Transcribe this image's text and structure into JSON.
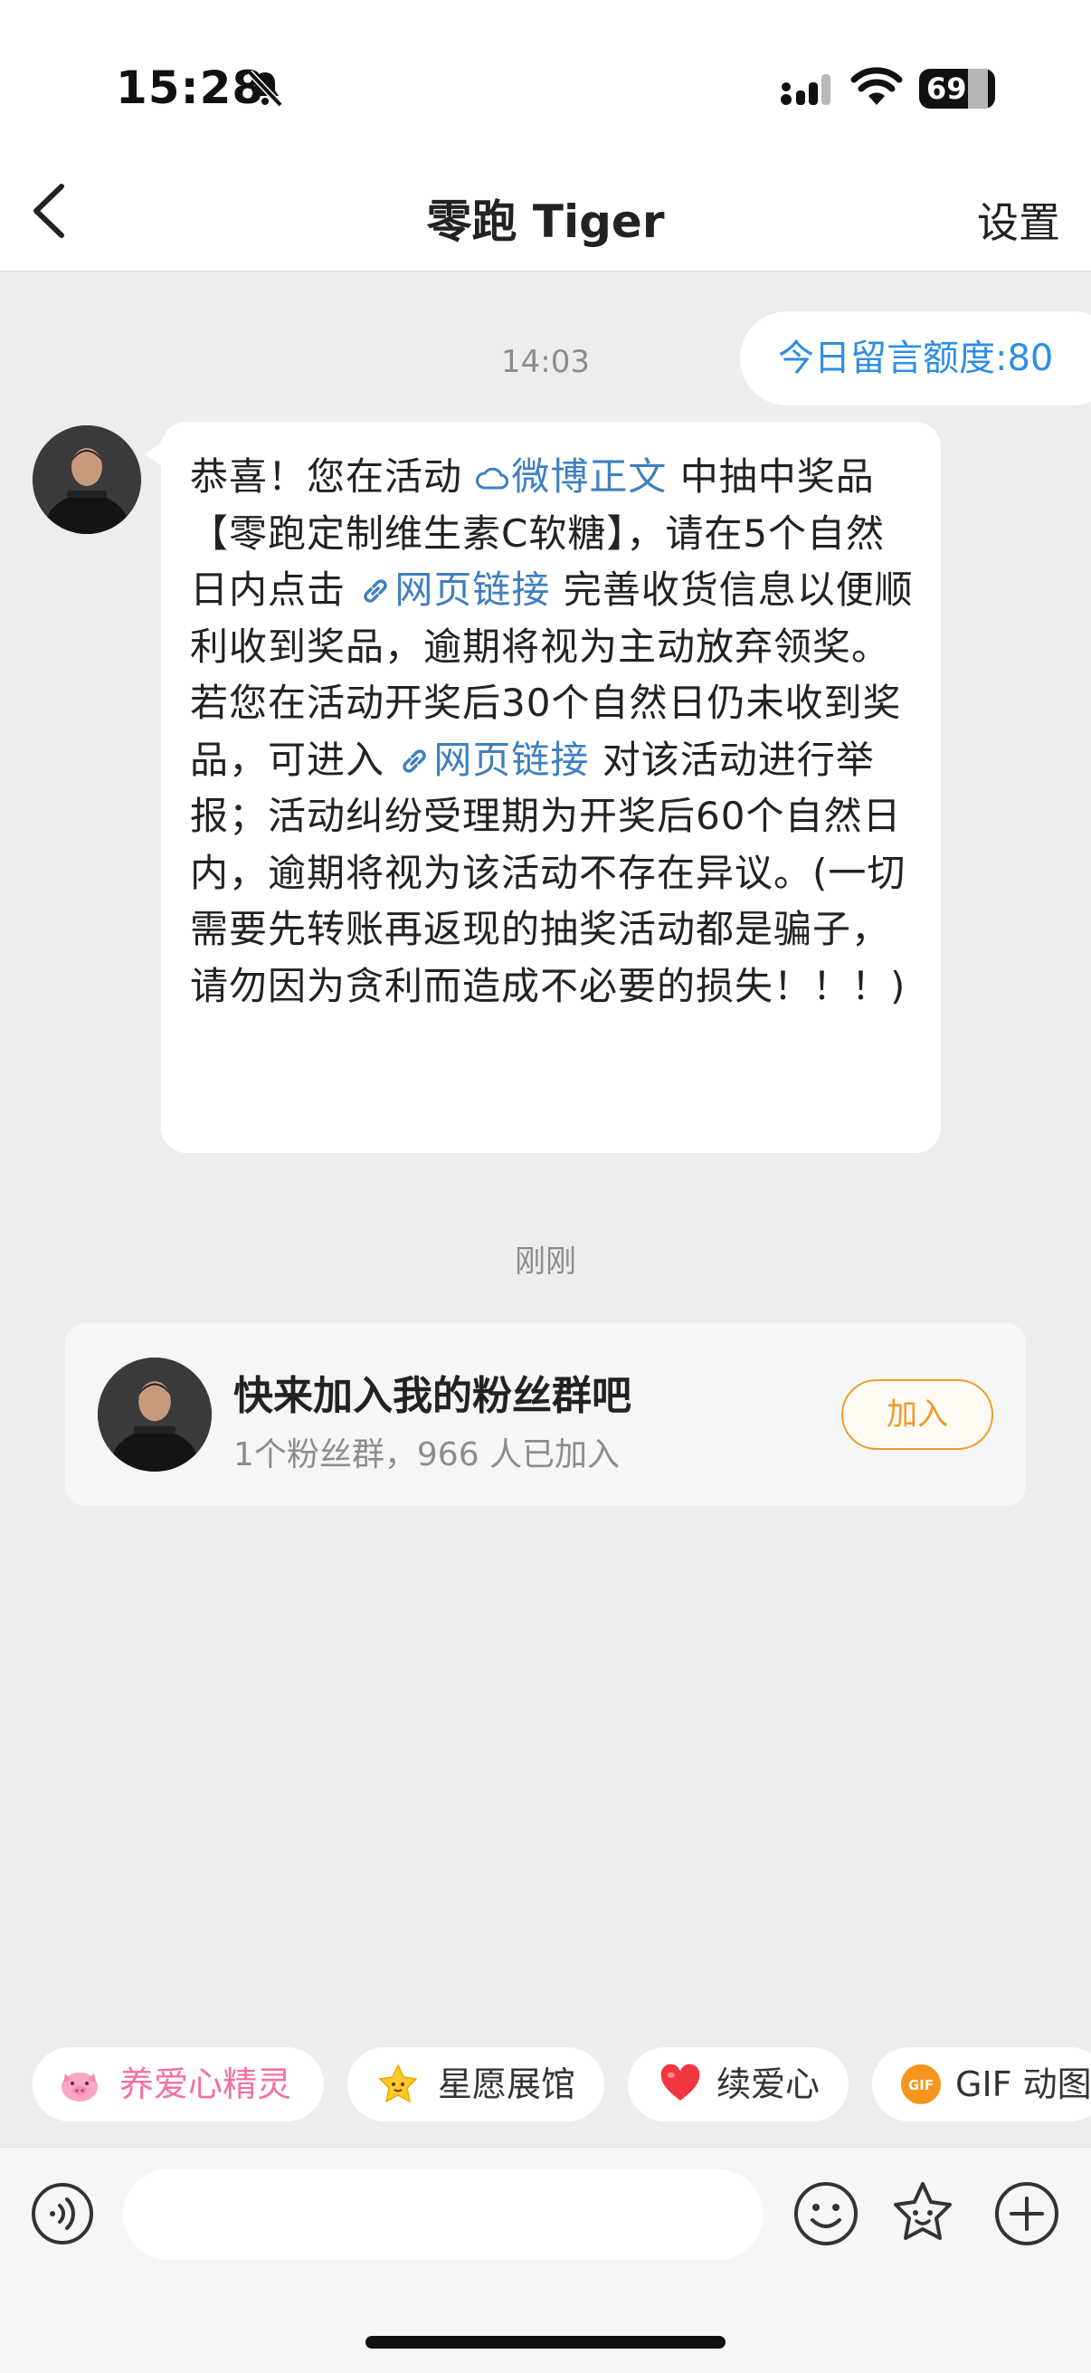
{
  "status_bar": {
    "time": "15:28",
    "battery": "69"
  },
  "nav": {
    "title": "零跑 Tiger",
    "settings": "设置"
  },
  "chat": {
    "timestamp1": "14:03",
    "quota": "今日留言额度:80",
    "message": {
      "p1": "恭喜！您在活动 ",
      "link1": "微博正文",
      "p2": " 中抽中奖品【零跑定制维生素C软糖】，请在5个自然日内点击 ",
      "link2": "网页链接",
      "p3": " 完善收货信息以便顺利收到奖品，逾期将视为主动放弃领奖。若您在活动开奖后30个自然日仍未收到奖品，可进入 ",
      "link3": "网页链接",
      "p4": " 对该活动进行举报；活动纠纷受理期为开奖后60个自然日内，逾期将视为该活动不存在异议。(一切需要先转账再返现的抽奖活动都是骗子，请勿因为贪利而造成不必要的损失！！！)"
    },
    "timestamp2": "刚刚",
    "fan_group": {
      "title": "快来加入我的粉丝群吧",
      "subtitle": "1个粉丝群，966 人已加入",
      "join_label": "加入"
    }
  },
  "quick_chips": [
    {
      "label": "养爱心精灵",
      "icon": "pig-icon",
      "color": "#f26fa5"
    },
    {
      "label": "星愿展馆",
      "icon": "star-face-icon",
      "color": "#333333"
    },
    {
      "label": "续爱心",
      "icon": "heart-icon",
      "color": "#333333"
    },
    {
      "label": "GIF 动图",
      "icon": "gif-icon",
      "color": "#333333"
    }
  ],
  "colors": {
    "link": "#3f7fbf",
    "accent_orange": "#f09a2c",
    "quota_blue": "#2f8de4",
    "background": "#ededed"
  }
}
